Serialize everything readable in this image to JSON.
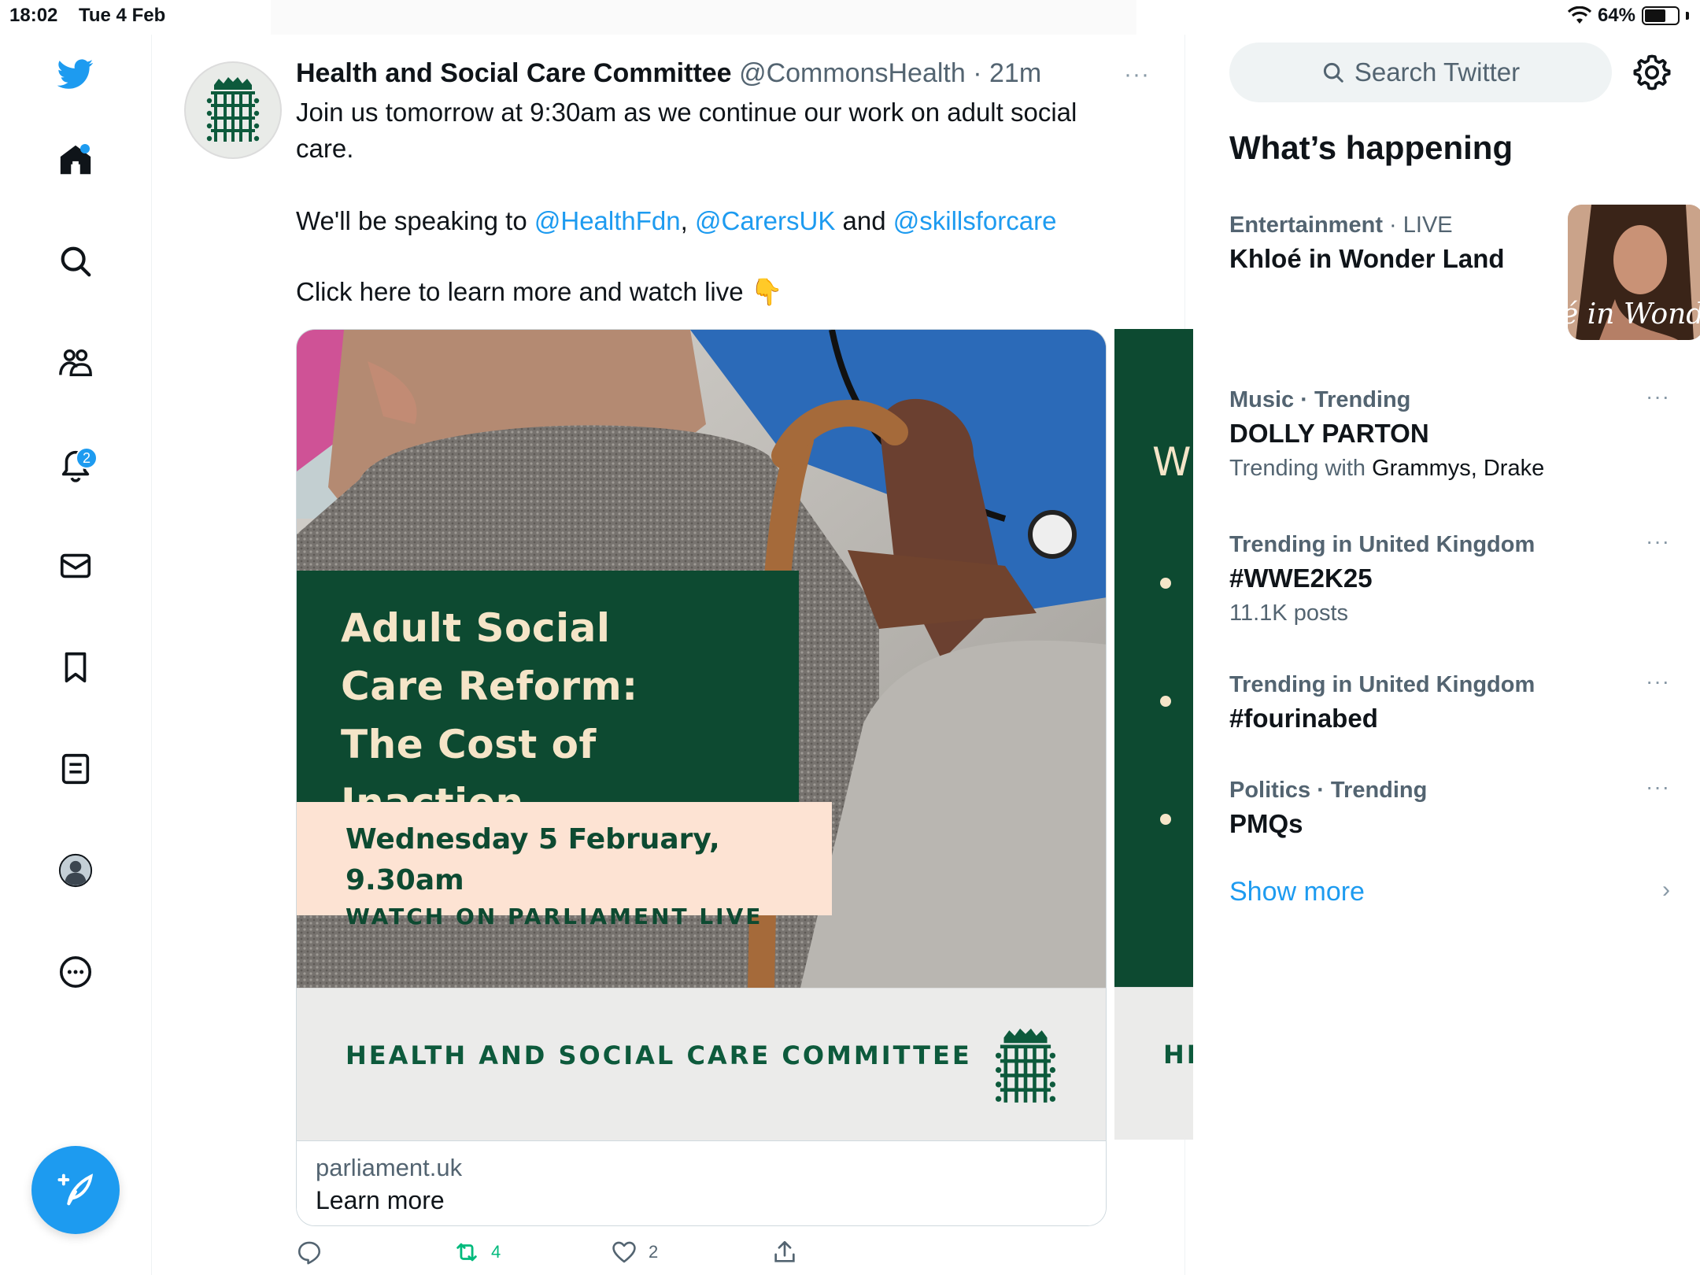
{
  "status_bar": {
    "time": "18:02",
    "date": "Tue 4 Feb",
    "dots": "•••",
    "battery": "64%",
    "battery_level": 0.64
  },
  "nav": {
    "notifications_badge": "2"
  },
  "tweet": {
    "name": "Health and Social Care Committee",
    "handle": "@CommonsHealth",
    "separator": " · ",
    "time": "21m",
    "more": "···",
    "text_line1": "Join us tomorrow at 9:30am as we continue our work on adult social care.",
    "text_pre": "We'll be speaking to ",
    "mention1": "@HealthFdn",
    "comma": ", ",
    "mention2": "@CarersUK",
    "and": " and ",
    "mention3": "@skillsforcare",
    "text_line3": "Click here to learn more and watch live",
    "emoji": "👇",
    "card": {
      "heading_1": "Adult Social",
      "heading_2": "Care Reform:",
      "heading_3": "The Cost of Inaction",
      "date": "Wednesday 5 February, 9.30am",
      "watch": "WATCH ON PARLIAMENT LIVE",
      "banner": "HEALTH AND SOCIAL CARE COMMITTEE",
      "domain": "parliament.uk",
      "cta": "Learn more",
      "second_card_letter": "W",
      "second_card_banner": "HI"
    },
    "retweets": "4",
    "likes": "2"
  },
  "right": {
    "search_placeholder": "Search Twitter",
    "section_title": "What’s happening",
    "trends": [
      {
        "category": "Entertainment",
        "sep": " · ",
        "tag": "LIVE",
        "name": "Khloé in Wonder Land",
        "thumb_text": "é in Wonder L"
      },
      {
        "category": "Music · Trending",
        "name": "DOLLY PARTON",
        "sub_pre": "Trending with ",
        "sub_dark": "Grammys, Drake"
      },
      {
        "category": "Trending in United Kingdom",
        "name": "#WWE2K25",
        "sub": "11.1K posts"
      },
      {
        "category": "Trending in United Kingdom",
        "name": "#fourinabed"
      },
      {
        "category": "Politics · Trending",
        "name": "PMQs"
      }
    ],
    "more_glyph": "···",
    "show_more": "Show more",
    "chevron": "›"
  },
  "colors": {
    "accent": "#1d9bf0",
    "parliament_green": "#0d4a31",
    "peach": "#fde3d3"
  }
}
